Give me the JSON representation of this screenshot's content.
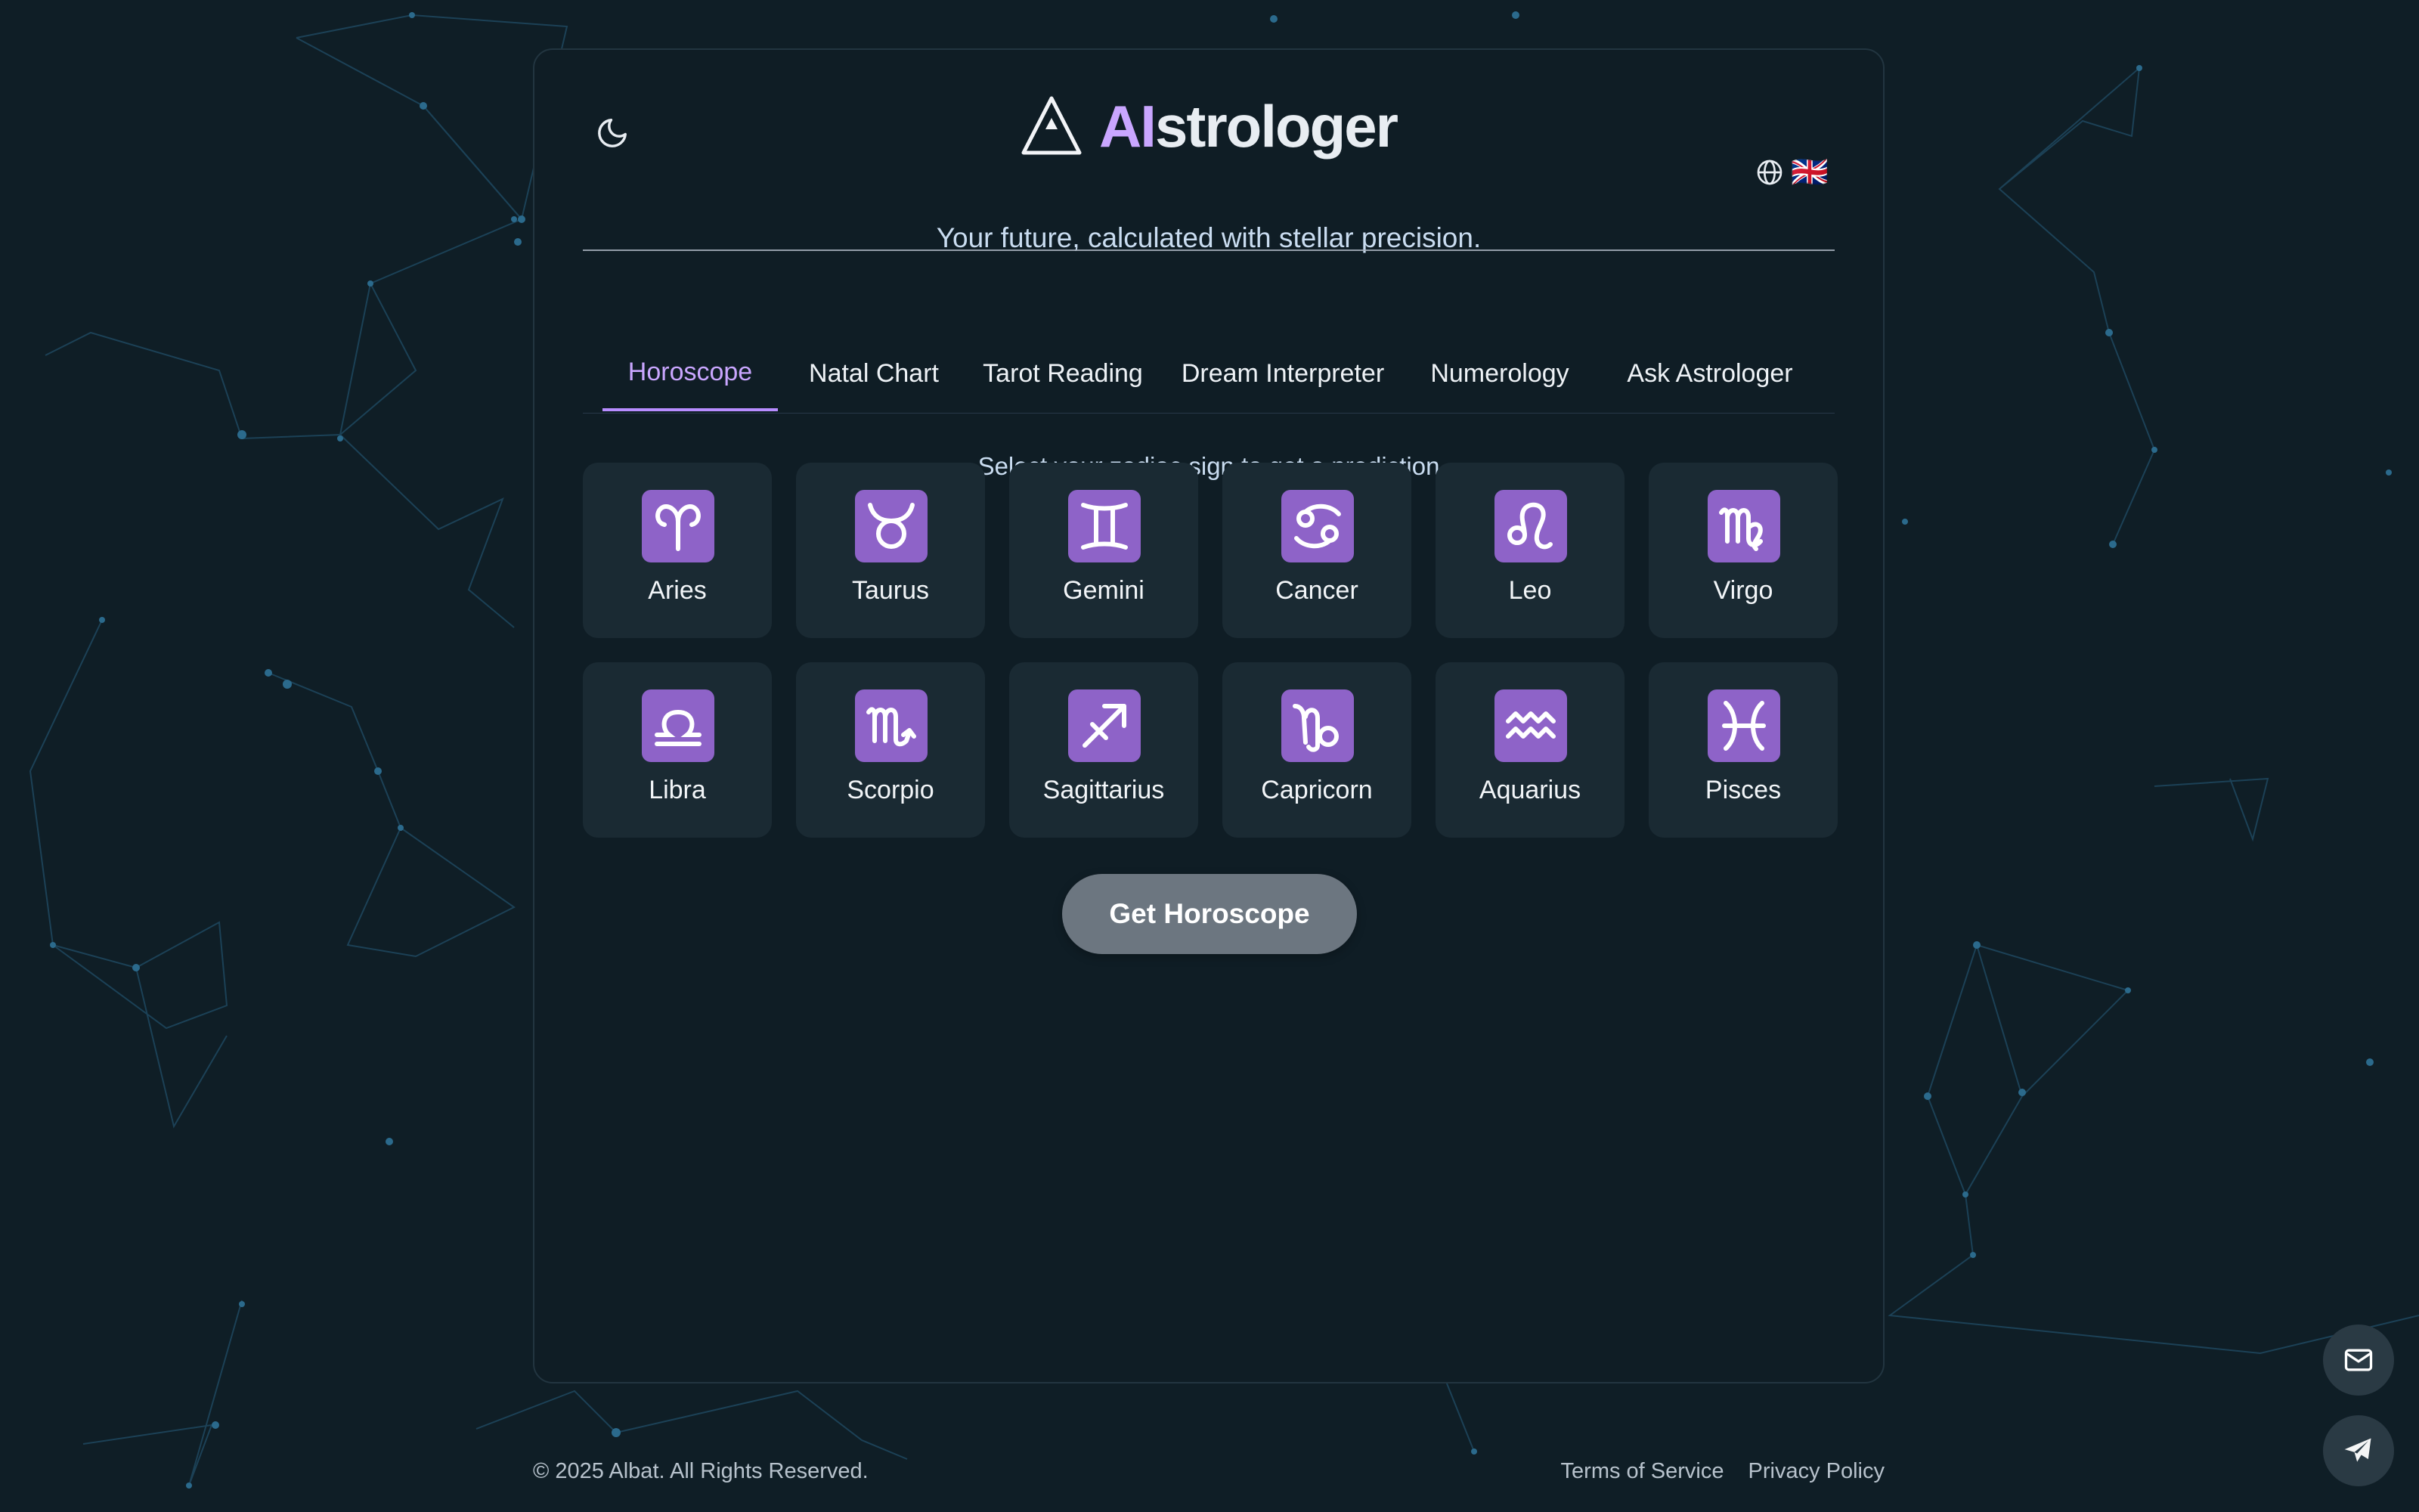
{
  "app": {
    "title_ai": "AI",
    "title_rest": "strologer",
    "subtitle": "Your future, calculated with stellar precision.",
    "accent": "#c9a6ff",
    "language": "🇬🇧"
  },
  "tabs": [
    {
      "label": "Horoscope",
      "active": true
    },
    {
      "label": "Natal Chart"
    },
    {
      "label": "Tarot Reading"
    },
    {
      "label": "Dream Interpreter"
    },
    {
      "label": "Numerology"
    },
    {
      "label": "Ask Astrologer"
    }
  ],
  "horoscope": {
    "prompt": "Select your zodiac sign to get a prediction",
    "signs": [
      {
        "name": "Aries",
        "glyph": "aries-icon"
      },
      {
        "name": "Taurus",
        "glyph": "taurus-icon"
      },
      {
        "name": "Gemini",
        "glyph": "gemini-icon"
      },
      {
        "name": "Cancer",
        "glyph": "cancer-icon"
      },
      {
        "name": "Leo",
        "glyph": "leo-icon"
      },
      {
        "name": "Virgo",
        "glyph": "virgo-icon"
      },
      {
        "name": "Libra",
        "glyph": "libra-icon"
      },
      {
        "name": "Scorpio",
        "glyph": "scorpio-icon"
      },
      {
        "name": "Sagittarius",
        "glyph": "sagittarius-icon"
      },
      {
        "name": "Capricorn",
        "glyph": "capricorn-icon"
      },
      {
        "name": "Aquarius",
        "glyph": "aquarius-icon"
      },
      {
        "name": "Pisces",
        "glyph": "pisces-icon"
      }
    ],
    "button_label": "Get Horoscope"
  },
  "footer": {
    "copyright": "© 2025 Albat. All Rights Reserved.",
    "terms": "Terms of Service",
    "privacy": "Privacy Policy"
  }
}
